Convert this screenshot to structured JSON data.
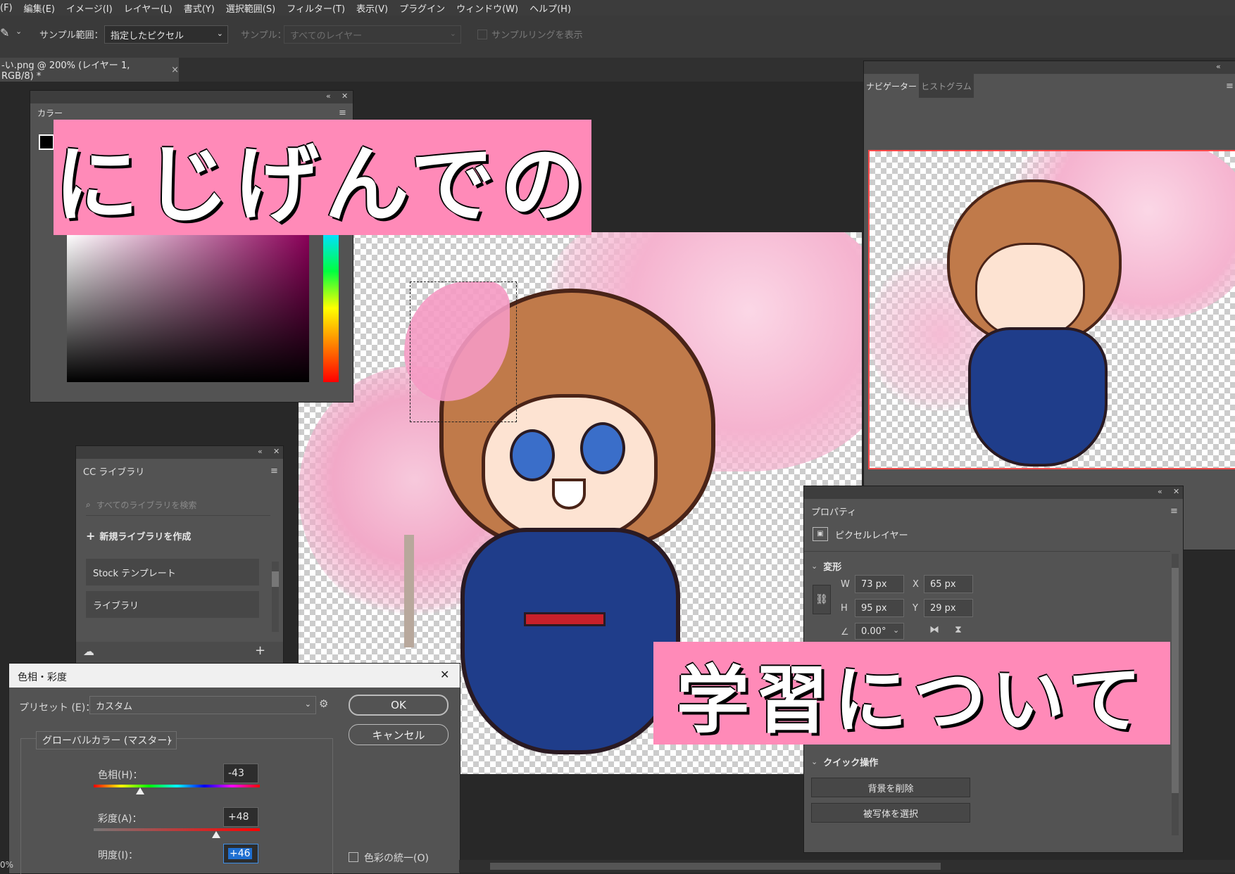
{
  "menu": [
    "(F)",
    "編集(E)",
    "イメージ(I)",
    "レイヤー(L)",
    "書式(Y)",
    "選択範囲(S)",
    "フィルター(T)",
    "表示(V)",
    "プラグイン",
    "ウィンドウ(W)",
    "ヘルプ(H)"
  ],
  "options": {
    "sample_range_label": "サンプル範囲：",
    "sample_range_value": "指定したピクセル",
    "sample_label": "サンプル：",
    "sample_value": "すべてのレイヤー",
    "sample_ring_label": "サンプルリングを表示"
  },
  "document_tab": {
    "title": "-い.png @ 200% (レイヤー 1, RGB/8) *",
    "close": "×"
  },
  "color_panel": {
    "title": "カラー"
  },
  "banner_top": "にじげんでの",
  "banner_bottom": "学習について",
  "cc_library": {
    "title": "CC ライブラリ",
    "search_placeholder": "すべてのライブラリを検索",
    "create_label": "新規ライブラリを作成",
    "items": [
      "Stock テンプレート",
      "ライブラリ"
    ]
  },
  "navigator": {
    "tabs": [
      "ナビゲーター",
      "ヒストグラム"
    ]
  },
  "properties": {
    "title": "プロパティ",
    "layer_type": "ピクセルレイヤー",
    "transform_title": "変形",
    "w_label": "W",
    "w_value": "73 px",
    "x_label": "X",
    "x_value": "65 px",
    "h_label": "H",
    "h_value": "95 px",
    "y_label": "Y",
    "y_value": "29 px",
    "angle_value": "0.00°",
    "quick_title": "クイック操作",
    "remove_bg": "背景を削除",
    "select_subject": "被写体を選択"
  },
  "hue_dialog": {
    "title": "色相・彩度",
    "close": "✕",
    "preset_label": "プリセット (E)：",
    "preset_value": "カスタム",
    "ok": "OK",
    "cancel": "キャンセル",
    "channel_value": "グローバルカラー (マスター)",
    "hue_label": "色相(H)：",
    "hue_value": "-43",
    "sat_label": "彩度(A)：",
    "sat_value": "+48",
    "light_label": "明度(I)：",
    "light_value": "+46",
    "colorize_label": "色彩の統一(O)"
  },
  "zoom_fragment": "0%"
}
